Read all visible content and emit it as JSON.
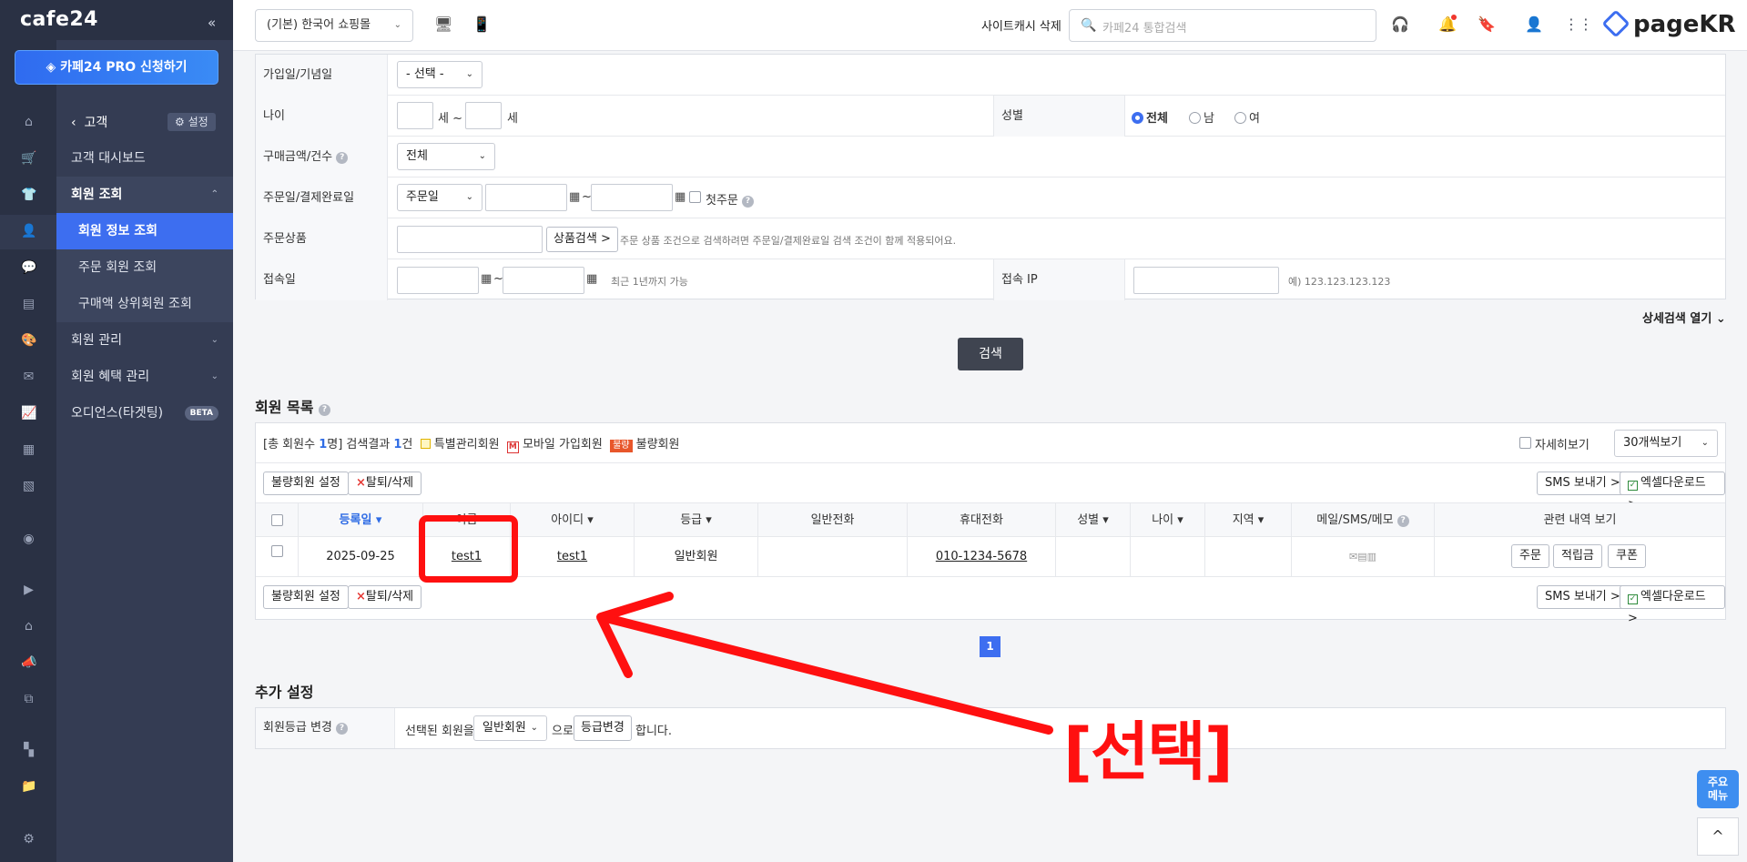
{
  "brand": {
    "logo": "cafe24",
    "pro_button": "카페24 PRO 신청하기"
  },
  "sidebar": {
    "back_label": "고객",
    "settings_label": "설정",
    "items": [
      {
        "label": "고객 대시보드"
      },
      {
        "label": "회원 조회"
      },
      {
        "label": "회원 정보 조회"
      },
      {
        "label": "주문 회원 조회"
      },
      {
        "label": "구매액 상위회원 조회"
      },
      {
        "label": "회원 관리"
      },
      {
        "label": "회원 혜택 관리"
      },
      {
        "label": "오디언스(타겟팅)",
        "badge": "BETA"
      }
    ]
  },
  "topbar": {
    "mall_select": "(기본) 한국어 쇼핑몰",
    "cache_clear": "사이트캐시 삭제",
    "search_placeholder": "카페24 통합검색",
    "partner_logo": "pageKR"
  },
  "form": {
    "join_date": {
      "label": "가입일/기념일",
      "select": "- 선택 -"
    },
    "age": {
      "label": "나이",
      "from_suffix": "세 ~",
      "to_suffix": "세"
    },
    "gender": {
      "label": "성별",
      "options": [
        "전체",
        "남",
        "여"
      ],
      "selected": "전체"
    },
    "purchase": {
      "label": "구매금액/건수",
      "select": "전체"
    },
    "order_date": {
      "label": "주문일/결제완료일",
      "select": "주문일",
      "tilde": "~",
      "first_order": "첫주문"
    },
    "product": {
      "label": "주문상품",
      "button": "상품검색 >",
      "note": "주문 상품 조건으로 검색하려면 주문일/결제완료일 검색 조건이 함께 적용되어요."
    },
    "access_date": {
      "label": "접속일",
      "tilde": "~",
      "note": "최근 1년까지 가능"
    },
    "access_ip": {
      "label": "접속 IP",
      "note": "예) 123.123.123.123"
    },
    "detail_toggle": "상세검색 열기",
    "search_button": "검색"
  },
  "member_list": {
    "title": "회원 목록",
    "summary_prefix": "[총 회원수 ",
    "summary_total": "1",
    "summary_mid": "명] 검색결과 ",
    "summary_result": "1",
    "summary_suffix": "건",
    "legend_special": "특별관리회원",
    "legend_mobile": "모바일 가입회원",
    "legend_bad_badge": "불량",
    "legend_bad": "불량회원",
    "detail_view": "자세히보기",
    "per_page": "30개씩보기",
    "btn_bad": "불량회원 설정",
    "btn_delete": "탈퇴/삭제",
    "btn_sms": "SMS 보내기 >",
    "btn_excel": "엑셀다운로드 >",
    "columns": [
      "등록일 ▾",
      "이름",
      "아이디 ▾",
      "등급 ▾",
      "일반전화",
      "휴대전화",
      "성별 ▾",
      "나이 ▾",
      "지역 ▾",
      "메일/SMS/메모",
      "관련 내역 보기"
    ],
    "rows": [
      {
        "date": "2025-09-25",
        "name": "test1",
        "id": "test1",
        "grade": "일반회원",
        "phone": "",
        "mobile": "010-1234-5678",
        "gender": "",
        "age": "",
        "region": ""
      }
    ],
    "row_buttons": [
      "주문",
      "적립금",
      "쿠폰"
    ],
    "page": "1"
  },
  "extra": {
    "title": "추가 설정",
    "label": "회원등급 변경",
    "text1": "선택된 회원을",
    "select": "일반회원",
    "text2": "으로",
    "button": "등급변경",
    "text3": "합니다."
  },
  "annotation": {
    "label": "[선택]",
    "color": "#ff1010"
  },
  "float": {
    "menu": "주요메뉴",
    "top": "^"
  },
  "colors": {
    "accent": "#3d6ef0",
    "sidebar": "#343c53",
    "highlight": "#ff1010"
  }
}
